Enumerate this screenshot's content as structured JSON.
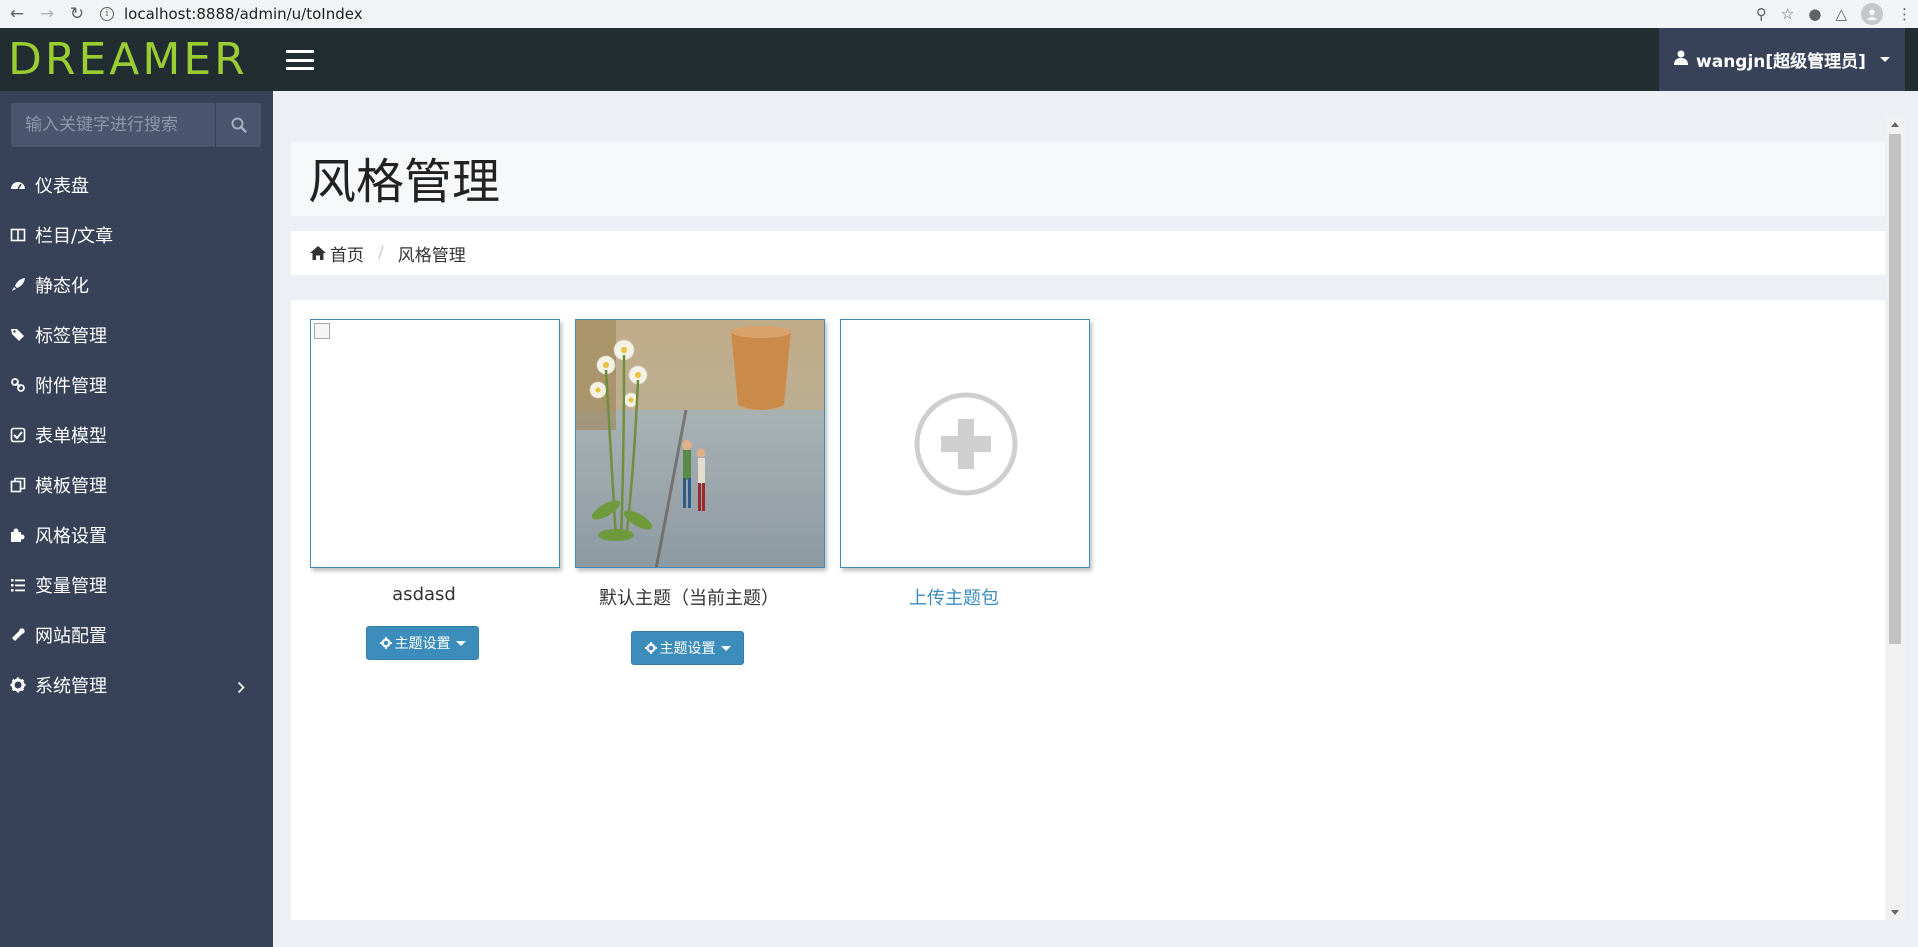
{
  "browser": {
    "url": "localhost:8888/admin/u/toIndex"
  },
  "header": {
    "logo_text": "DREAMER",
    "user_label": "wangjn[超级管理员]"
  },
  "sidebar": {
    "search_placeholder": "输入关键字进行搜索",
    "items": [
      {
        "label": "仪表盘",
        "icon": "dashboard-icon"
      },
      {
        "label": "栏目/文章",
        "icon": "columns-icon"
      },
      {
        "label": "静态化",
        "icon": "rocket-icon"
      },
      {
        "label": "标签管理",
        "icon": "tags-icon"
      },
      {
        "label": "附件管理",
        "icon": "link-icon"
      },
      {
        "label": "表单模型",
        "icon": "check-square-icon"
      },
      {
        "label": "模板管理",
        "icon": "copy-icon"
      },
      {
        "label": "风格设置",
        "icon": "puzzle-icon"
      },
      {
        "label": "变量管理",
        "icon": "list-icon"
      },
      {
        "label": "网站配置",
        "icon": "wrench-icon"
      },
      {
        "label": "系统管理",
        "icon": "gear-icon"
      }
    ]
  },
  "main": {
    "title": "风格管理",
    "breadcrumb": {
      "home": "首页",
      "current": "风格管理"
    },
    "themes": [
      {
        "name": "asdasd",
        "button": "主题设置"
      },
      {
        "name": "默认主题（当前主题）",
        "button": "主题设置"
      }
    ],
    "upload_label": "上传主题包"
  },
  "colors": {
    "header_bg": "#222d32",
    "sidebar_bg": "#374258",
    "accent": "#3c8dbc",
    "logo": "#9acd32"
  }
}
